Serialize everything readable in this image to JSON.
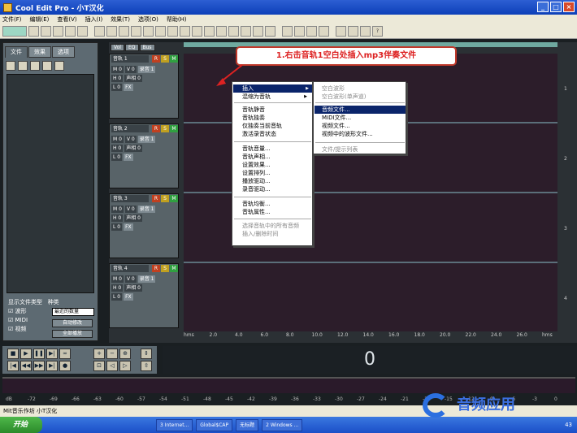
{
  "window": {
    "title": "Cool Edit Pro  - 小T汉化"
  },
  "menu": [
    "文件(F)",
    "编辑(E)",
    "查看(V)",
    "插入(I)",
    "效果(T)",
    "选项(O)",
    "帮助(H)"
  ],
  "left": {
    "tabs": [
      "文件",
      "效果",
      "选项"
    ],
    "show_type": "显示文件类型",
    "sort_label": "种类",
    "types": [
      "波形",
      "MIDI",
      "视频"
    ],
    "sort_value": "最近的数量",
    "buttons": [
      "自动修改",
      "全部播放"
    ]
  },
  "bvtabs": [
    "Vol",
    "EQ",
    "Bus"
  ],
  "tracks": [
    {
      "name": "音轨 1",
      "vol": "V 0",
      "pan": "声相 0",
      "out": "录音 1",
      "rows": [
        "M 0",
        "H 0",
        "L 0"
      ],
      "fx": "FX"
    },
    {
      "name": "音轨 2",
      "vol": "V 0",
      "pan": "声相 0",
      "out": "录音 1",
      "rows": [
        "M 0",
        "H 0",
        "L 0"
      ],
      "fx": "FX"
    },
    {
      "name": "音轨 3",
      "vol": "V 0",
      "pan": "声相 0",
      "out": "录音 1",
      "rows": [
        "M 0",
        "H 0",
        "L 0"
      ],
      "fx": "FX"
    },
    {
      "name": "音轨 4",
      "vol": "V 0",
      "pan": "声相 0",
      "out": "录音 1",
      "rows": [
        "M 0",
        "H 0",
        "L 0"
      ],
      "fx": "FX"
    }
  ],
  "ruler": [
    "hms",
    "2.0",
    "4.0",
    "6.0",
    "8.0",
    "10.0",
    "12.0",
    "14.0",
    "16.0",
    "18.0",
    "20.0",
    "22.0",
    "24.0",
    "26.0",
    "hms"
  ],
  "vruler": [
    "1",
    "2",
    "3",
    "4"
  ],
  "annotation": "1.右击音轨1空白处插入mp3伴奏文件",
  "context_menu": [
    "插入",
    "混缩为音轨",
    "音轨静音",
    "音轨独奏",
    "仅独奏当前音轨",
    "激活录音状态",
    "音轨音量...",
    "音轨声相...",
    "设置效果...",
    "设置排列...",
    "播放驱动...",
    "录音驱动...",
    "音轨均衡...",
    "音轨属性...",
    "选择音轨中的所有音频",
    "插入/删除时间"
  ],
  "submenu": [
    "空白波形",
    "空白波形(单声道)",
    "音频文件...",
    "MIDI文件...",
    "视频文件...",
    "视频中的波形文件...",
    "文件/提示列表"
  ],
  "time_display": "0",
  "level_scale": [
    "dB",
    "-72",
    "-69",
    "-66",
    "-63",
    "-60",
    "-57",
    "-54",
    "-51",
    "-48",
    "-45",
    "-42",
    "-39",
    "-36",
    "-33",
    "-30",
    "-27",
    "-24",
    "-21",
    "-18",
    "-15",
    "-12",
    "-9",
    "-6",
    "-3",
    "0"
  ],
  "status": "Mit音乐作坊 小T汉化",
  "taskbar": {
    "start": "开始",
    "tasks": [
      "3 Internet...",
      "Global$CAP",
      "无标题",
      "2 Windows ..."
    ],
    "clock": "43"
  },
  "watermark": "音频应用"
}
